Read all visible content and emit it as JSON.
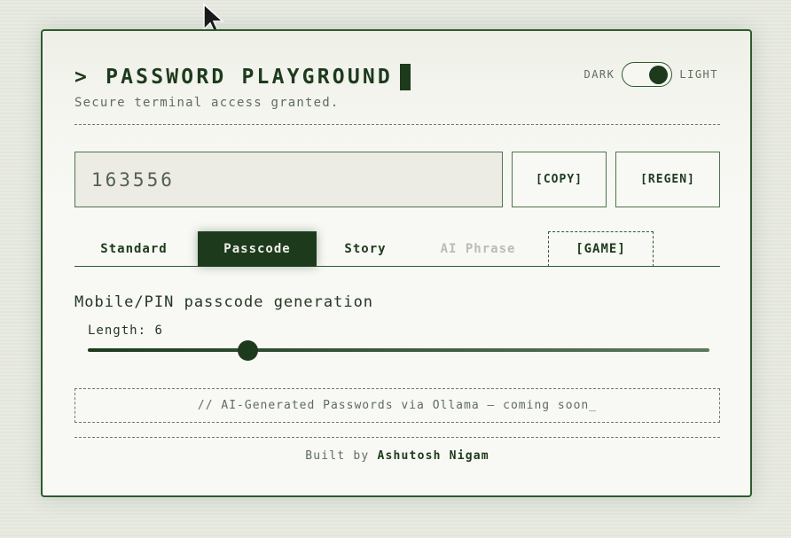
{
  "header": {
    "prompt_symbol": ">",
    "title": "PASSWORD PLAYGROUND",
    "subtitle": "Secure terminal access granted."
  },
  "theme_toggle": {
    "dark_label": "DARK",
    "light_label": "LIGHT",
    "selected": "LIGHT"
  },
  "password": {
    "value": "163556"
  },
  "actions": {
    "copy_label": "[COPY]",
    "regen_label": "[REGEN]"
  },
  "tabs": [
    {
      "label": "Standard",
      "active": false,
      "disabled": false
    },
    {
      "label": "Passcode",
      "active": true,
      "disabled": false
    },
    {
      "label": "Story",
      "active": false,
      "disabled": false
    },
    {
      "label": "AI Phrase",
      "active": false,
      "disabled": true
    },
    {
      "label": "[GAME]",
      "active": false,
      "disabled": false
    }
  ],
  "mode": {
    "title": "Mobile/PIN passcode generation",
    "length_label": "Length:",
    "length_value": "6",
    "slider_fraction": 0.257
  },
  "notice": {
    "text": "// AI-Generated Passwords via Ollama — coming soon_"
  },
  "footer": {
    "prefix": "Built by",
    "author": "Ashutosh Nigam"
  },
  "colors": {
    "accent": "#1d3a1d",
    "border": "#2e5a2e",
    "muted": "#5f6d5f",
    "disabled": "#b9bdb6"
  }
}
